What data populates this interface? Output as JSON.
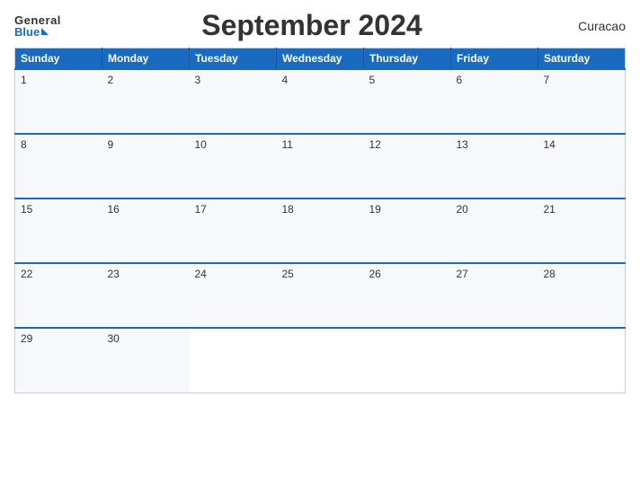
{
  "header": {
    "logo_general": "General",
    "logo_blue": "Blue",
    "title": "September 2024",
    "location": "Curacao"
  },
  "days_of_week": [
    "Sunday",
    "Monday",
    "Tuesday",
    "Wednesday",
    "Thursday",
    "Friday",
    "Saturday"
  ],
  "weeks": [
    [
      "1",
      "2",
      "3",
      "4",
      "5",
      "6",
      "7"
    ],
    [
      "8",
      "9",
      "10",
      "11",
      "12",
      "13",
      "14"
    ],
    [
      "15",
      "16",
      "17",
      "18",
      "19",
      "20",
      "21"
    ],
    [
      "22",
      "23",
      "24",
      "25",
      "26",
      "27",
      "28"
    ],
    [
      "29",
      "30",
      "",
      "",
      "",
      "",
      ""
    ]
  ]
}
